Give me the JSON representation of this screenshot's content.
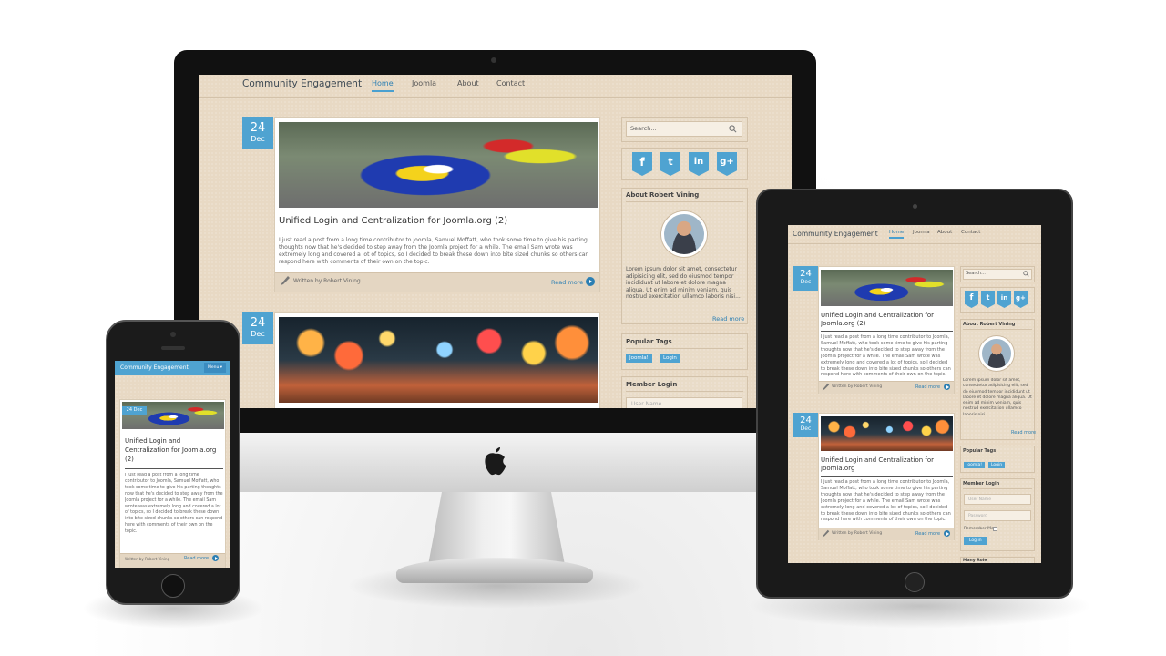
{
  "site": {
    "title": "Community Engagement",
    "nav": [
      "Home",
      "Joomla",
      "About",
      "Contact"
    ],
    "mobile_menu_label": "Menu ▾"
  },
  "posts": [
    {
      "day": "24",
      "month": "Dec",
      "title": "Unified Login and Centralization for Joomla.org (2)",
      "excerpt": "I just read a post from a long time contributor to Joomla, Samuel Moffatt, who took some time to give his parting thoughts now that he's decided to step away from the Joomla project for a while. The email Sam wrote was extremely long and covered a lot of topics, so I decided to break these down into bite sized chunks so others can respond here with comments of their own on the  topic.",
      "author": "Written by Robert Vining",
      "read_more": "Read more"
    },
    {
      "day": "24",
      "month": "Dec",
      "title": "Unified Login and Centralization for Joomla.org",
      "excerpt": "I just read a post from a long time contributor to Joomla, Samuel Moffatt, who took some time to give his parting thoughts now that he's decided to step away from the Joomla project for a while. The email Sam wrote was extremely long and covered a lot of topics, so I decided to break these down into bite sized chunks so others can respond here with comments of their own on the  topic.",
      "author": "Written by Robert Vining",
      "read_more": "Read more"
    }
  ],
  "sidebar": {
    "search_placeholder": "Search...",
    "social": [
      "f",
      "t",
      "in",
      "g+"
    ],
    "about_title": "About Robert Vining",
    "about_text": "Lorem ipsum dolor sit amet, consectetur adipisicing elit, sed do eiusmod tempor incididunt ut labore et dolore magna aliqua. Ut enim ad minim veniam, quis nostrud exercitation ullamco laboris nisi...",
    "about_read_more": "Read more",
    "tags_title": "Popular Tags",
    "tags": [
      "Joomla!",
      "Login"
    ],
    "login_title": "Member Login",
    "username_placeholder": "User Name",
    "password_placeholder": "Password",
    "remember_me": "Remember Me",
    "login_button": "Log in",
    "more_title": "Many Role"
  },
  "colors": {
    "accent": "#4fa3d1",
    "paper": "#e8d9c4",
    "link": "#2c7fb3"
  }
}
